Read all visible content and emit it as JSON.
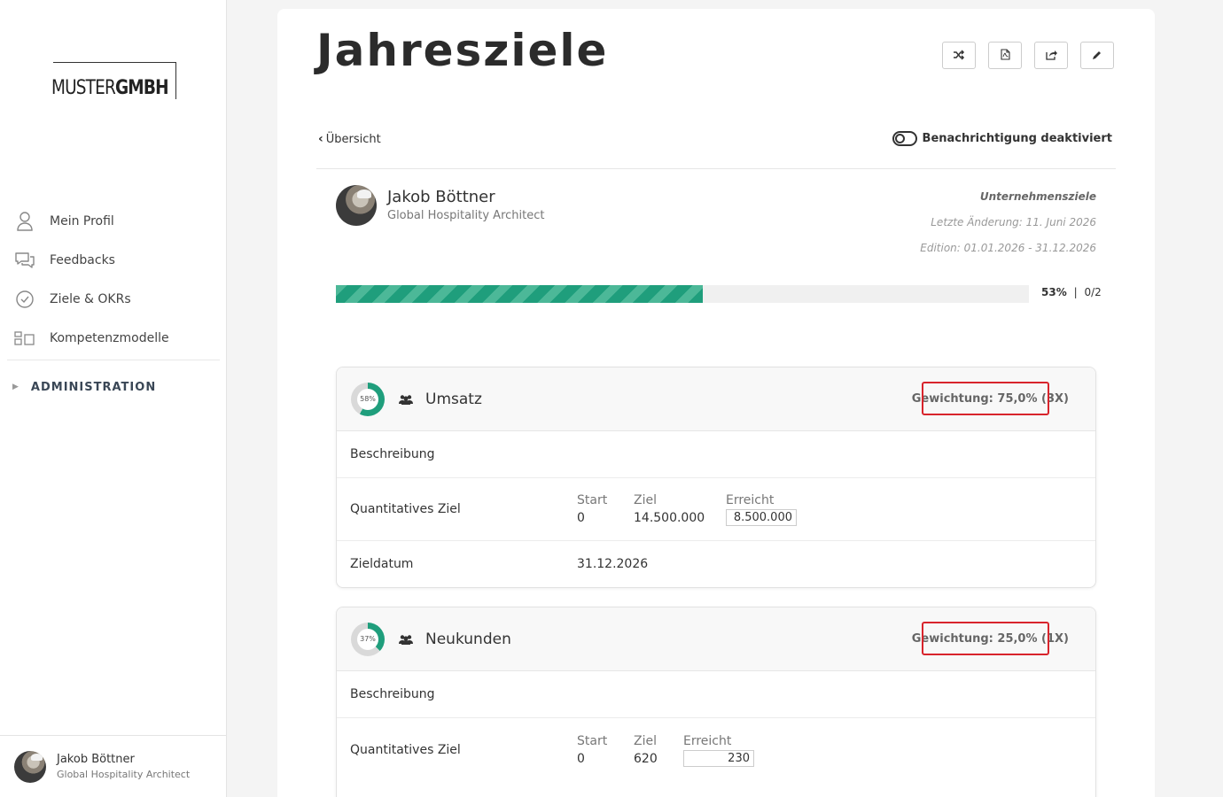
{
  "sidebar": {
    "logo": {
      "part1": "MUSTER",
      "part2": "GMBH"
    },
    "items": [
      {
        "label": "Mein Profil",
        "icon": "user-icon"
      },
      {
        "label": "Feedbacks",
        "icon": "chat-icon"
      },
      {
        "label": "Ziele & OKRs",
        "icon": "check-circle-icon"
      },
      {
        "label": "Kompetenzmodelle",
        "icon": "grid-icon"
      }
    ],
    "admin": {
      "label": "ADMINISTRATION"
    },
    "user": {
      "name": "Jakob Böttner",
      "role": "Global Hospitality Architect"
    }
  },
  "page": {
    "title": "Jahresziele",
    "toolbar": [
      "shuffle-icon",
      "pdf-icon",
      "share-icon",
      "edit-icon"
    ],
    "back_label": "Übersicht",
    "notify_label": "Benachrichtigung deaktiviert",
    "person": {
      "name": "Jakob Böttner",
      "role": "Global Hospitality Architect"
    },
    "meta": {
      "company": "Unternehmensziele",
      "last_change": "Letzte Änderung: 11. Juni 2026",
      "edition": "Edition: 01.01.2026 - 31.12.2026"
    },
    "progress": {
      "percent_value": 53,
      "percent": "53%",
      "sep": "|",
      "count": "0/2"
    }
  },
  "goals": [
    {
      "title": "Umsatz",
      "progress_value": 58,
      "progress_label": "58%",
      "weight": "Gewichtung: 75,0%",
      "multiplier": "(3X)",
      "description_label": "Beschreibung",
      "quant_label": "Quantitatives Ziel",
      "start_label": "Start",
      "start": "0",
      "target_label": "Ziel",
      "target": "14.500.000",
      "achieved_label": "Erreicht",
      "achieved": "8.500.000",
      "date_label": "Zieldatum",
      "date": "31.12.2026"
    },
    {
      "title": "Neukunden",
      "progress_value": 37,
      "progress_label": "37%",
      "weight": "Gewichtung: 25,0%",
      "multiplier": "(1X)",
      "description_label": "Beschreibung",
      "quant_label": "Quantitatives Ziel",
      "start_label": "Start",
      "start": "0",
      "target_label": "Ziel",
      "target": "620",
      "achieved_label": "Erreicht",
      "achieved": "230"
    }
  ],
  "colors": {
    "accent": "#1f9e7c",
    "accent_light": "#4cb898",
    "highlight": "#d8242c"
  }
}
